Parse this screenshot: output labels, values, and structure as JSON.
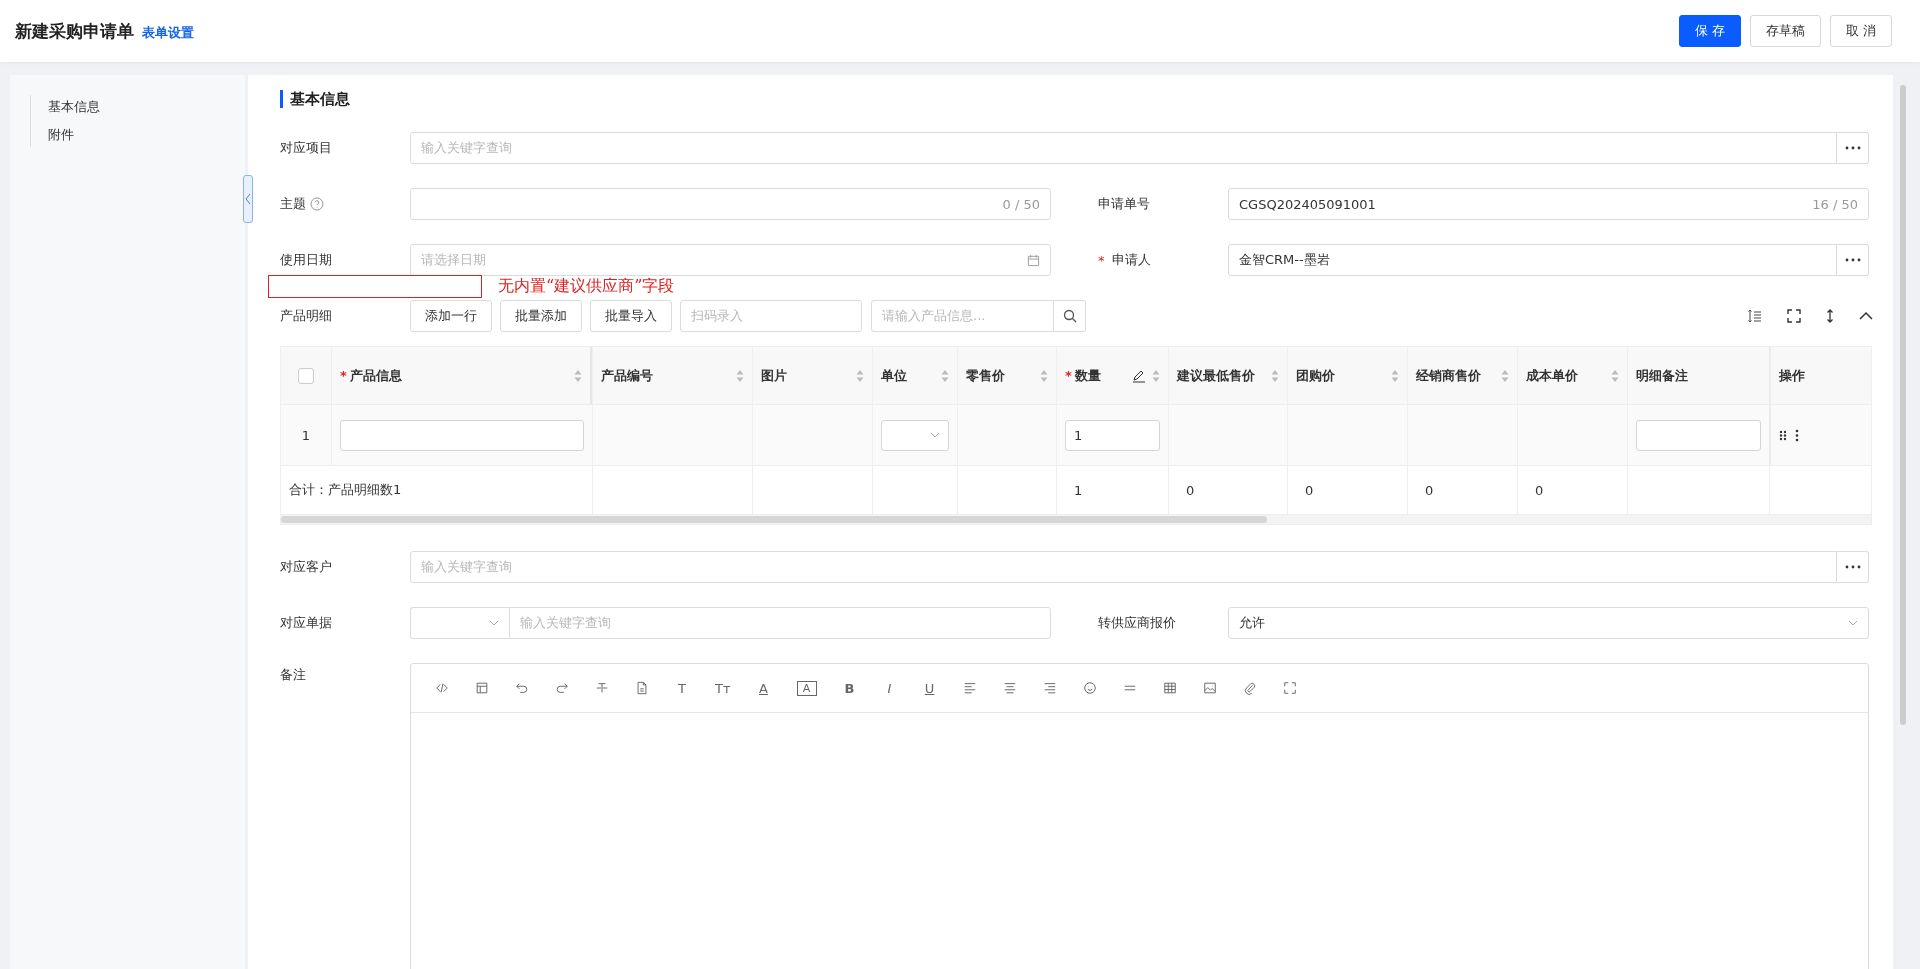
{
  "header": {
    "title": "新建采购申请单",
    "settings_link": "表单设置",
    "buttons": [
      {
        "label": "保 存",
        "primary": true
      },
      {
        "label": "存草稿",
        "primary": false
      },
      {
        "label": "取 消",
        "primary": false
      }
    ]
  },
  "sidebar": {
    "items": [
      {
        "label": "基本信息"
      },
      {
        "label": "附件"
      }
    ]
  },
  "section_title": "基本信息",
  "project": {
    "label": "对应项目",
    "placeholder": "输入关键字查询"
  },
  "subject": {
    "label": "主题",
    "counter": "0 / 50"
  },
  "request_no": {
    "label": "申请单号",
    "value": "CGSQ202405091001",
    "counter": "16 / 50"
  },
  "use_date": {
    "label": "使用日期",
    "placeholder": "请选择日期"
  },
  "applicant": {
    "label": "申请人",
    "required_mark": "*",
    "value": "金智CRM--墨岩"
  },
  "annotation": "无内置“建议供应商”字段",
  "products": {
    "label": "产品明细",
    "actions": [
      "添加一行",
      "批量添加",
      "批量导入"
    ],
    "scan_placeholder": "扫码录入",
    "search_placeholder": "请输入产品信息...",
    "select_all_checked": false,
    "columns": [
      {
        "label": "产品信息",
        "required_mark": "*",
        "sortable": true,
        "editable": false
      },
      {
        "label": "产品编号",
        "sortable": true,
        "editable": false
      },
      {
        "label": "图片",
        "sortable": true,
        "editable": false
      },
      {
        "label": "单位",
        "sortable": true,
        "editable": false
      },
      {
        "label": "零售价",
        "sortable": true,
        "editable": false
      },
      {
        "label": "数量",
        "required_mark": "*",
        "sortable": true,
        "editable": true
      },
      {
        "label": "建议最低售价",
        "sortable": true,
        "editable": false
      },
      {
        "label": "团购价",
        "sortable": true,
        "editable": false
      },
      {
        "label": "经销商售价",
        "sortable": true,
        "editable": false
      },
      {
        "label": "成本单价",
        "sortable": true,
        "editable": false
      },
      {
        "label": "明细备注",
        "sortable": false,
        "editable": false
      },
      {
        "label": "操作",
        "sortable": false,
        "editable": false
      }
    ],
    "rows": [
      {
        "index": "1",
        "cells": [
          {
            "kind": "input"
          },
          {
            "kind": "blank"
          },
          {
            "kind": "blank"
          },
          {
            "kind": "select"
          },
          {
            "kind": "blank"
          },
          {
            "kind": "input",
            "value": "1"
          },
          {
            "kind": "blank"
          },
          {
            "kind": "blank"
          },
          {
            "kind": "blank"
          },
          {
            "kind": "blank"
          },
          {
            "kind": "input"
          },
          {
            "kind": "actions"
          }
        ]
      }
    ],
    "total": {
      "label": "合计：产品明细数1",
      "cells": [
        {
          "kind": "blank"
        },
        {
          "kind": "blank"
        },
        {
          "kind": "blank"
        },
        {
          "kind": "blank"
        },
        {
          "kind": "text",
          "value": "1"
        },
        {
          "kind": "text",
          "value": "0"
        },
        {
          "kind": "text",
          "value": "0"
        },
        {
          "kind": "text",
          "value": "0"
        },
        {
          "kind": "text",
          "value": "0"
        },
        {
          "kind": "blank"
        },
        {
          "kind": "blank"
        }
      ]
    }
  },
  "customer": {
    "label": "对应客户",
    "placeholder": "输入关键字查询"
  },
  "related_doc": {
    "label": "对应单据",
    "placeholder": "输入关键字查询"
  },
  "supplier_quote": {
    "label": "转供应商报价",
    "value": "允许"
  },
  "notes": {
    "label": "备注",
    "toolbar": [
      {
        "kind": "code"
      },
      {
        "kind": "layout"
      },
      {
        "kind": "undo"
      },
      {
        "kind": "redo"
      },
      {
        "kind": "strike"
      },
      {
        "kind": "document"
      },
      {
        "kind": "heading",
        "glyph": "T"
      },
      {
        "kind": "font-size",
        "glyph": "Tт"
      },
      {
        "kind": "font-color",
        "glyph": "A"
      },
      {
        "kind": "background-color",
        "glyph": "A"
      },
      {
        "kind": "bold",
        "glyph": "B"
      },
      {
        "kind": "italic",
        "glyph": "I"
      },
      {
        "kind": "underline",
        "glyph": "U"
      },
      {
        "kind": "align-left"
      },
      {
        "kind": "align-center"
      },
      {
        "kind": "align-right"
      },
      {
        "kind": "emoji"
      },
      {
        "kind": "rule"
      },
      {
        "kind": "table"
      },
      {
        "kind": "image"
      },
      {
        "kind": "attachment"
      },
      {
        "kind": "fullscreen"
      }
    ]
  }
}
